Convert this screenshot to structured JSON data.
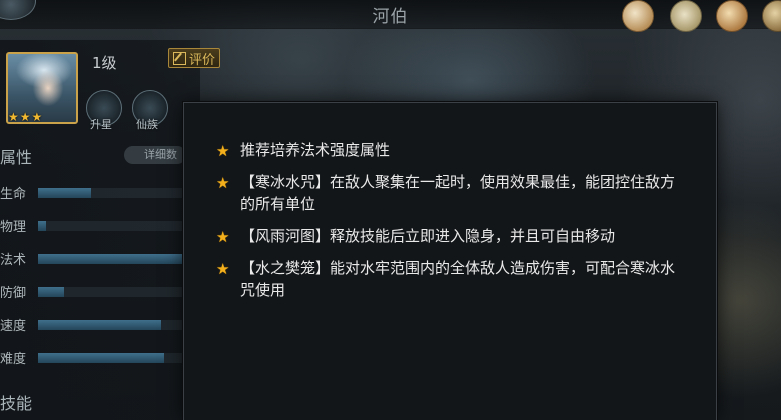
{
  "header": {
    "title": "河伯",
    "icons": [
      "dumpling-icon",
      "scroll-icon",
      "coin-icon",
      "bag-icon"
    ]
  },
  "hero": {
    "level": "1级",
    "rate_label": "评价",
    "stars": "★★★",
    "advance_label": "升星",
    "faction_label": "仙族"
  },
  "attributes": {
    "title": "属性",
    "detail_label": "详细数",
    "stats": [
      {
        "label": "生命",
        "value": 0.33
      },
      {
        "label": "物理",
        "value": 0.05
      },
      {
        "label": "法术",
        "value": 1.0
      },
      {
        "label": "防御",
        "value": 0.16
      },
      {
        "label": "速度",
        "value": 0.77
      },
      {
        "label": "难度",
        "value": 0.79
      }
    ]
  },
  "skills": {
    "title": "技能"
  },
  "tips": [
    "推荐培养法术强度属性",
    "【寒冰水咒】在敌人聚集在一起时，使用效果最佳，能团控住敌方的所有单位",
    "【风雨河图】释放技能后立即进入隐身，并且可自由移动",
    "【水之樊笼】能对水牢范围内的全体敌人造成伤害，可配合寒冰水咒使用"
  ],
  "colors": {
    "accent_gold": "#f3b01c",
    "stat_bar": "#3f6f8c",
    "modal_bg": "#131619"
  }
}
